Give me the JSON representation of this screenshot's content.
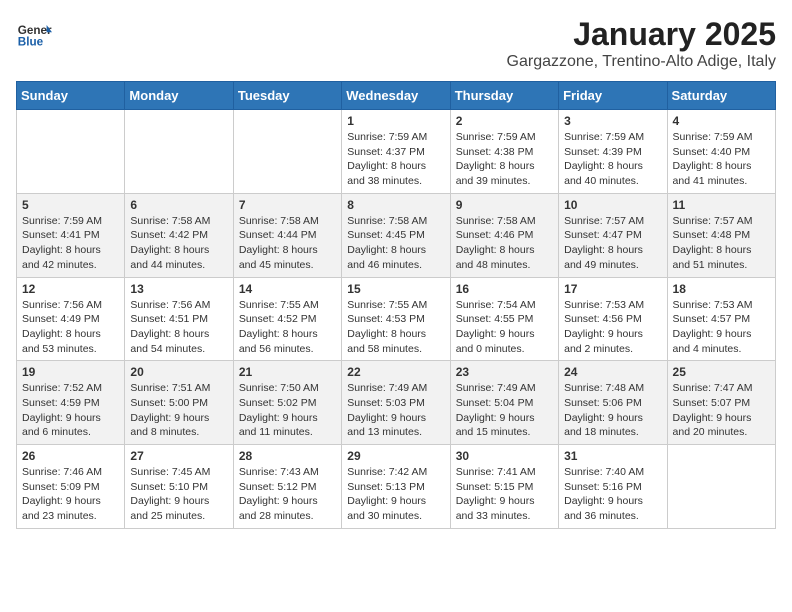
{
  "header": {
    "logo_text_general": "General",
    "logo_text_blue": "Blue",
    "title": "January 2025",
    "subtitle": "Gargazzone, Trentino-Alto Adige, Italy"
  },
  "calendar": {
    "days_of_week": [
      "Sunday",
      "Monday",
      "Tuesday",
      "Wednesday",
      "Thursday",
      "Friday",
      "Saturday"
    ],
    "weeks": [
      [
        {
          "day": "",
          "info": ""
        },
        {
          "day": "",
          "info": ""
        },
        {
          "day": "",
          "info": ""
        },
        {
          "day": "1",
          "info": "Sunrise: 7:59 AM\nSunset: 4:37 PM\nDaylight: 8 hours and 38 minutes."
        },
        {
          "day": "2",
          "info": "Sunrise: 7:59 AM\nSunset: 4:38 PM\nDaylight: 8 hours and 39 minutes."
        },
        {
          "day": "3",
          "info": "Sunrise: 7:59 AM\nSunset: 4:39 PM\nDaylight: 8 hours and 40 minutes."
        },
        {
          "day": "4",
          "info": "Sunrise: 7:59 AM\nSunset: 4:40 PM\nDaylight: 8 hours and 41 minutes."
        }
      ],
      [
        {
          "day": "5",
          "info": "Sunrise: 7:59 AM\nSunset: 4:41 PM\nDaylight: 8 hours and 42 minutes."
        },
        {
          "day": "6",
          "info": "Sunrise: 7:58 AM\nSunset: 4:42 PM\nDaylight: 8 hours and 44 minutes."
        },
        {
          "day": "7",
          "info": "Sunrise: 7:58 AM\nSunset: 4:44 PM\nDaylight: 8 hours and 45 minutes."
        },
        {
          "day": "8",
          "info": "Sunrise: 7:58 AM\nSunset: 4:45 PM\nDaylight: 8 hours and 46 minutes."
        },
        {
          "day": "9",
          "info": "Sunrise: 7:58 AM\nSunset: 4:46 PM\nDaylight: 8 hours and 48 minutes."
        },
        {
          "day": "10",
          "info": "Sunrise: 7:57 AM\nSunset: 4:47 PM\nDaylight: 8 hours and 49 minutes."
        },
        {
          "day": "11",
          "info": "Sunrise: 7:57 AM\nSunset: 4:48 PM\nDaylight: 8 hours and 51 minutes."
        }
      ],
      [
        {
          "day": "12",
          "info": "Sunrise: 7:56 AM\nSunset: 4:49 PM\nDaylight: 8 hours and 53 minutes."
        },
        {
          "day": "13",
          "info": "Sunrise: 7:56 AM\nSunset: 4:51 PM\nDaylight: 8 hours and 54 minutes."
        },
        {
          "day": "14",
          "info": "Sunrise: 7:55 AM\nSunset: 4:52 PM\nDaylight: 8 hours and 56 minutes."
        },
        {
          "day": "15",
          "info": "Sunrise: 7:55 AM\nSunset: 4:53 PM\nDaylight: 8 hours and 58 minutes."
        },
        {
          "day": "16",
          "info": "Sunrise: 7:54 AM\nSunset: 4:55 PM\nDaylight: 9 hours and 0 minutes."
        },
        {
          "day": "17",
          "info": "Sunrise: 7:53 AM\nSunset: 4:56 PM\nDaylight: 9 hours and 2 minutes."
        },
        {
          "day": "18",
          "info": "Sunrise: 7:53 AM\nSunset: 4:57 PM\nDaylight: 9 hours and 4 minutes."
        }
      ],
      [
        {
          "day": "19",
          "info": "Sunrise: 7:52 AM\nSunset: 4:59 PM\nDaylight: 9 hours and 6 minutes."
        },
        {
          "day": "20",
          "info": "Sunrise: 7:51 AM\nSunset: 5:00 PM\nDaylight: 9 hours and 8 minutes."
        },
        {
          "day": "21",
          "info": "Sunrise: 7:50 AM\nSunset: 5:02 PM\nDaylight: 9 hours and 11 minutes."
        },
        {
          "day": "22",
          "info": "Sunrise: 7:49 AM\nSunset: 5:03 PM\nDaylight: 9 hours and 13 minutes."
        },
        {
          "day": "23",
          "info": "Sunrise: 7:49 AM\nSunset: 5:04 PM\nDaylight: 9 hours and 15 minutes."
        },
        {
          "day": "24",
          "info": "Sunrise: 7:48 AM\nSunset: 5:06 PM\nDaylight: 9 hours and 18 minutes."
        },
        {
          "day": "25",
          "info": "Sunrise: 7:47 AM\nSunset: 5:07 PM\nDaylight: 9 hours and 20 minutes."
        }
      ],
      [
        {
          "day": "26",
          "info": "Sunrise: 7:46 AM\nSunset: 5:09 PM\nDaylight: 9 hours and 23 minutes."
        },
        {
          "day": "27",
          "info": "Sunrise: 7:45 AM\nSunset: 5:10 PM\nDaylight: 9 hours and 25 minutes."
        },
        {
          "day": "28",
          "info": "Sunrise: 7:43 AM\nSunset: 5:12 PM\nDaylight: 9 hours and 28 minutes."
        },
        {
          "day": "29",
          "info": "Sunrise: 7:42 AM\nSunset: 5:13 PM\nDaylight: 9 hours and 30 minutes."
        },
        {
          "day": "30",
          "info": "Sunrise: 7:41 AM\nSunset: 5:15 PM\nDaylight: 9 hours and 33 minutes."
        },
        {
          "day": "31",
          "info": "Sunrise: 7:40 AM\nSunset: 5:16 PM\nDaylight: 9 hours and 36 minutes."
        },
        {
          "day": "",
          "info": ""
        }
      ]
    ]
  }
}
